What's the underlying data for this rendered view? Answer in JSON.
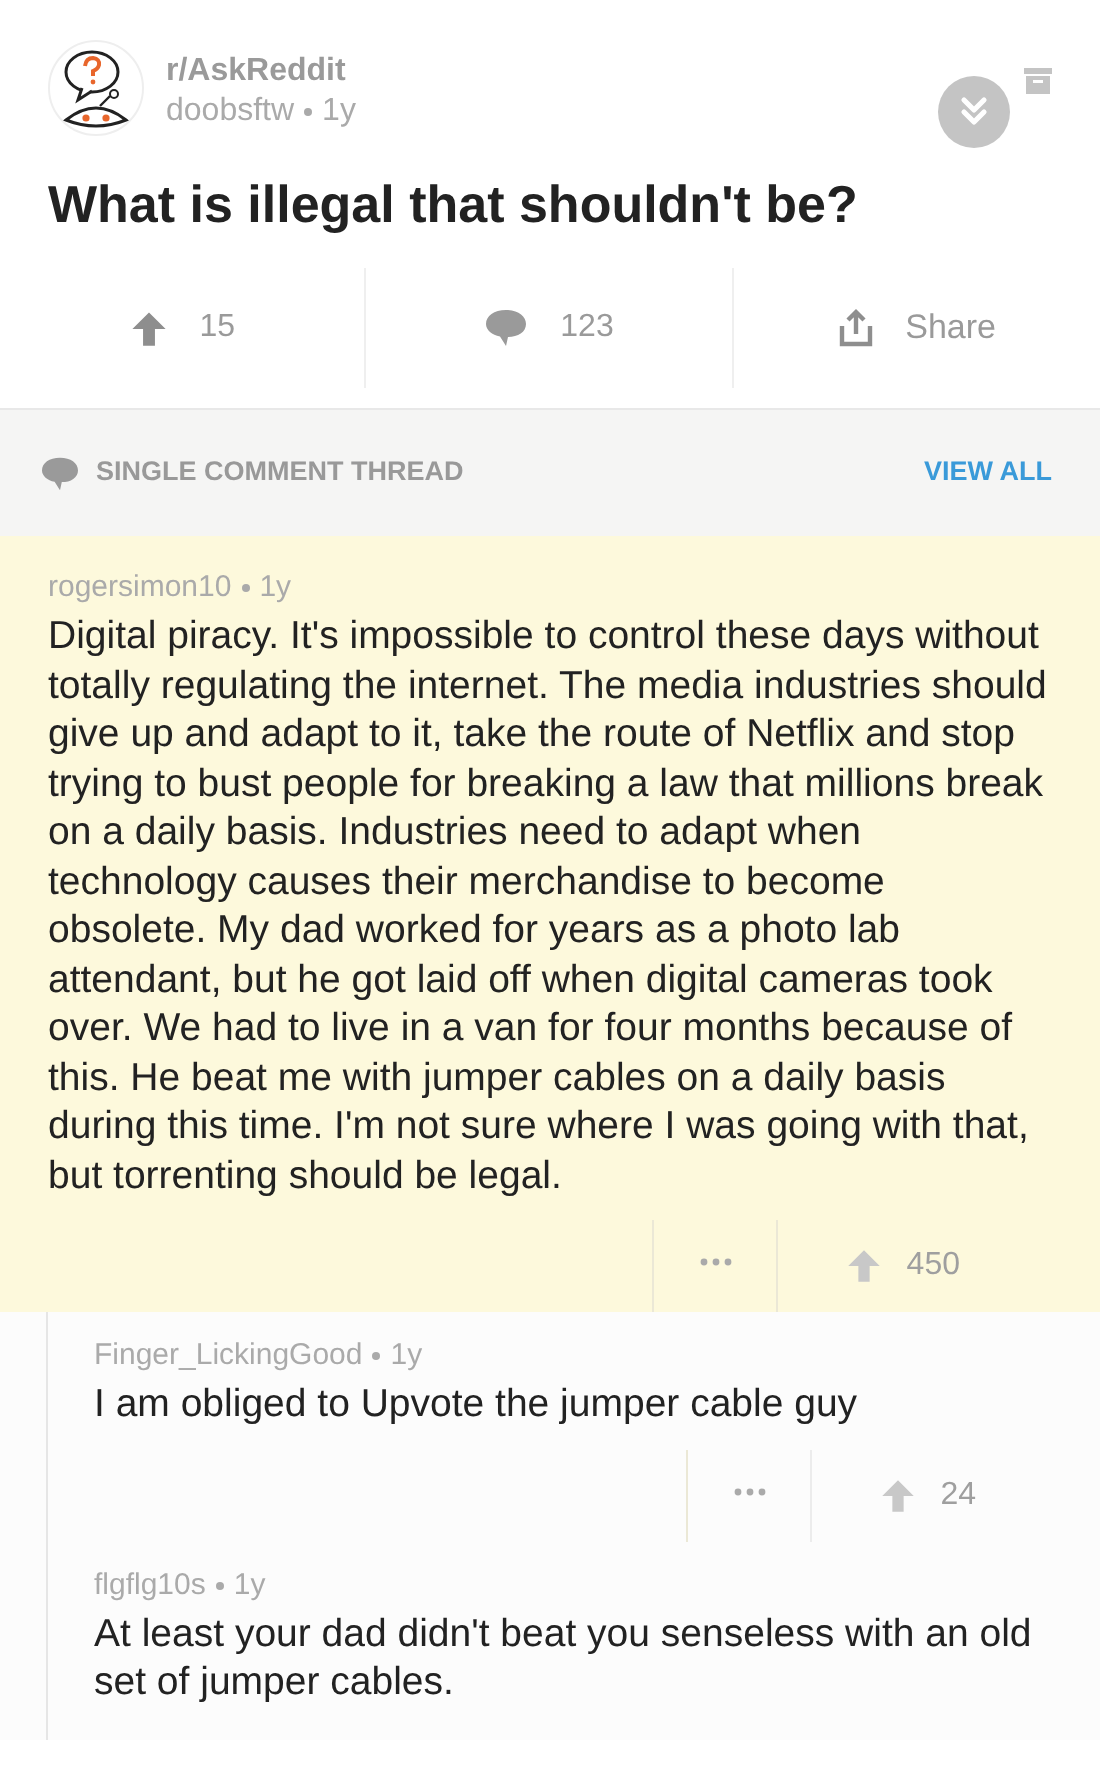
{
  "post": {
    "subreddit": "r/AskReddit",
    "author": "doobsftw",
    "age": "1y",
    "title": "What is illegal that shouldn't be?"
  },
  "post_actions": {
    "upvotes": "15",
    "comments": "123",
    "share": "Share"
  },
  "thread_bar": {
    "label": "SINGLE COMMENT THREAD",
    "view_all": "VIEW ALL"
  },
  "comments": [
    {
      "author": "rogersimon10",
      "age": "1y",
      "highlighted": true,
      "nested": false,
      "score": "450",
      "body": "Digital piracy. It's impossible to control these days without totally regulating the internet. The media industries should give up and adapt to it, take the route of Netflix and stop trying to bust people for breaking a law that millions break on a daily basis. Industries need to adapt when technology causes their merchandise to become obsolete. My dad worked for years as a photo lab attendant, but he got laid off when digital cameras took over. We had to live in a van for four months because of this. He beat me with jumper cables on a daily basis during this time. I'm not sure where I was going with that, but torrenting should be legal."
    },
    {
      "author": "Finger_LickingGood",
      "age": "1y",
      "highlighted": false,
      "nested": true,
      "score": "24",
      "body": "I am obliged to Upvote the jumper cable guy"
    },
    {
      "author": "flgflg10s",
      "age": "1y",
      "highlighted": false,
      "nested": true,
      "body": "At least your dad didn't beat you senseless with an old set of jumper cables."
    }
  ]
}
